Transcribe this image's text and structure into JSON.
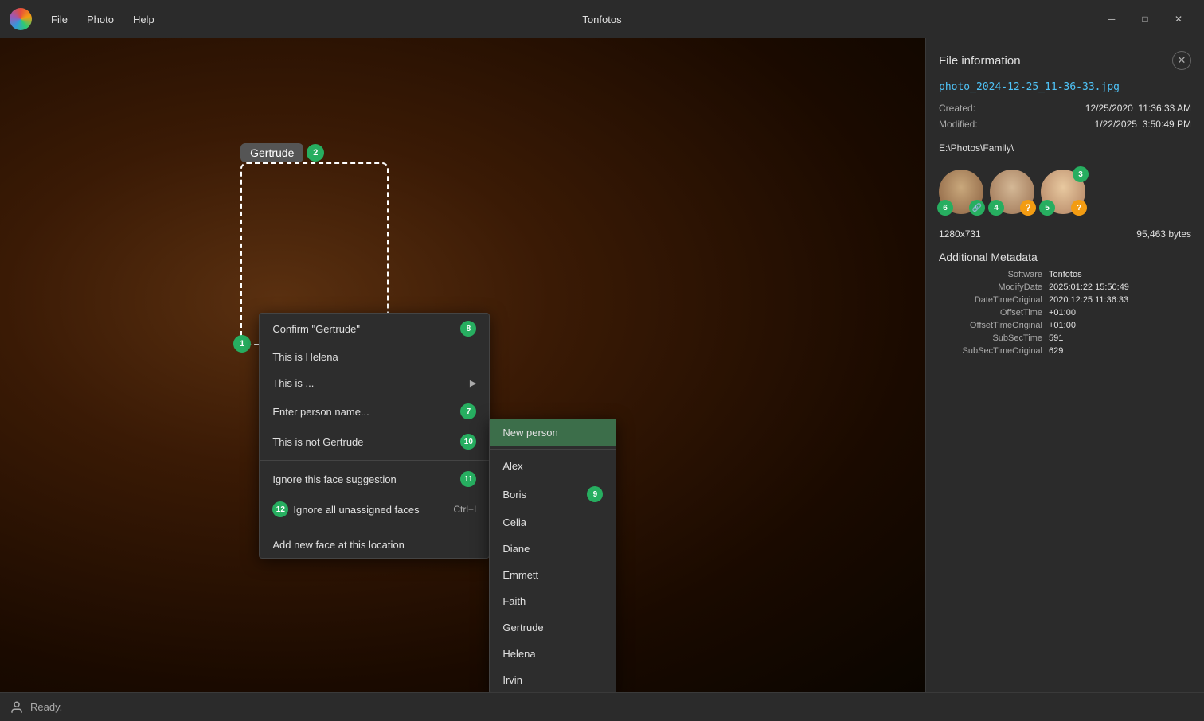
{
  "titlebar": {
    "app_icon_label": "Tonfotos icon",
    "menu_file": "File",
    "menu_photo": "Photo",
    "menu_help": "Help",
    "app_title": "Tonfotos",
    "btn_minimize": "─",
    "btn_maximize": "□",
    "btn_close": "✕"
  },
  "photo": {
    "face_label": "Gertrude",
    "badges": {
      "b1": "1",
      "b2": "2"
    }
  },
  "context_menu": {
    "item_confirm": "Confirm \"Gertrude\"",
    "item_this_is_helena": "This is Helena",
    "item_this_is": "This is ...",
    "item_enter_name": "Enter person name...",
    "item_not_gertrude": "This is not Gertrude",
    "item_ignore_face": "Ignore this face suggestion",
    "item_ignore_all": "Ignore all unassigned faces",
    "item_ignore_all_shortcut": "Ctrl+I",
    "item_add_face": "Add new face at this location",
    "badges": {
      "b8": "8",
      "b7": "7",
      "b10": "10",
      "b11": "11",
      "b12": "12"
    }
  },
  "submenu": {
    "item_new_person": "New person",
    "item_alex": "Alex",
    "item_boris": "Boris",
    "item_celia": "Celia",
    "item_diane": "Diane",
    "item_emmett": "Emmett",
    "item_faith": "Faith",
    "item_gertrude": "Gertrude",
    "item_helena": "Helena",
    "item_irvin": "Irvin",
    "badges": {
      "b9": "9"
    }
  },
  "right_panel": {
    "title": "File information",
    "close_btn": "✕",
    "filename": "photo_2024-12-25_11-36-33.jpg",
    "created_label": "Created:",
    "created_date": "12/25/2020",
    "created_time": "11:36:33 AM",
    "modified_label": "Modified:",
    "modified_date": "1/22/2025",
    "modified_time": "3:50:49 PM",
    "filepath": "E:\\Photos\\Family\\",
    "dimensions": "1280x731",
    "filesize": "95,463 bytes",
    "additional_metadata_title": "Additional Metadata",
    "meta": [
      {
        "key": "Software",
        "value": "Tonfotos"
      },
      {
        "key": "ModifyDate",
        "value": "2025:01:22 15:50:49"
      },
      {
        "key": "DateTimeOriginal",
        "value": "2020:12:25 11:36:33"
      },
      {
        "key": "OffsetTime",
        "value": "+01:00"
      },
      {
        "key": "OffsetTimeOriginal",
        "value": "+01:00"
      },
      {
        "key": "SubSecTime",
        "value": "591"
      },
      {
        "key": "SubSecTimeOriginal",
        "value": "629"
      }
    ],
    "face_badges": {
      "b3": "3",
      "b4": "4",
      "b5": "5",
      "b6": "6"
    }
  },
  "statusbar": {
    "status": "Ready."
  }
}
